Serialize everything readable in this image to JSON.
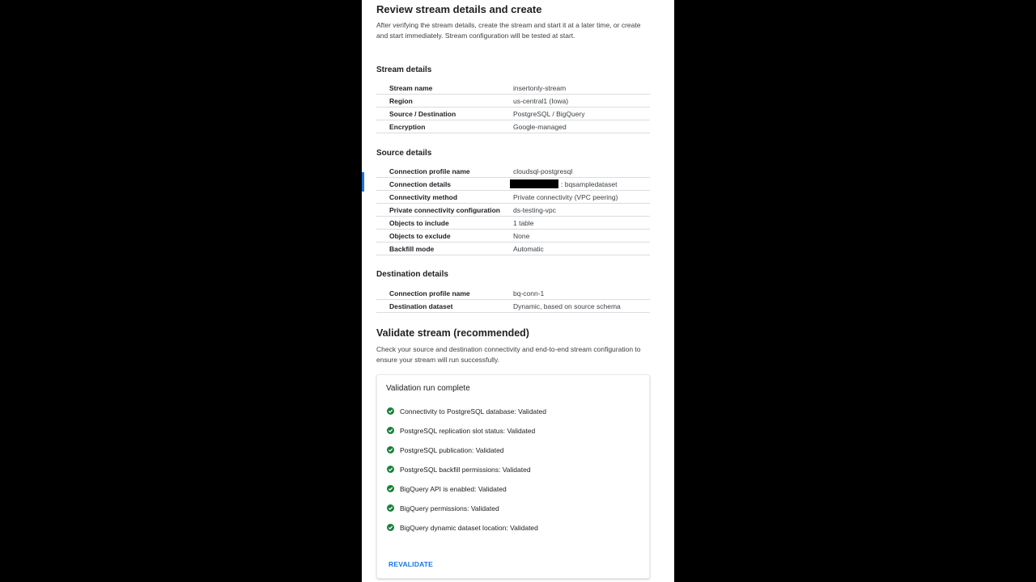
{
  "page": {
    "title": "Review stream details and create",
    "description": "After verifying the stream details, create the stream and start it at a later time, or create and start immediately. Stream configuration will be tested at start."
  },
  "stream_details": {
    "title": "Stream details",
    "rows": [
      {
        "label": "Stream name",
        "value": "insertonly-stream"
      },
      {
        "label": "Region",
        "value": "us-central1 (Iowa)"
      },
      {
        "label": "Source / Destination",
        "value": "PostgreSQL / BigQuery"
      },
      {
        "label": "Encryption",
        "value": "Google-managed"
      }
    ]
  },
  "source_details": {
    "title": "Source details",
    "rows": [
      {
        "label": "Connection profile name",
        "value": "cloudsql-postgresql"
      },
      {
        "label": "Connection details",
        "value": ": bqsampledataset"
      },
      {
        "label": "Connectivity method",
        "value": "Private connectivity (VPC peering)"
      },
      {
        "label": "Private connectivity configuration",
        "value": "ds-testing-vpc"
      },
      {
        "label": "Objects to include",
        "value": "1 table"
      },
      {
        "label": "Objects to exclude",
        "value": "None"
      },
      {
        "label": "Backfill mode",
        "value": "Automatic"
      }
    ]
  },
  "destination_details": {
    "title": "Destination details",
    "rows": [
      {
        "label": "Connection profile name",
        "value": "bq-conn-1"
      },
      {
        "label": "Destination dataset",
        "value": "Dynamic, based on source schema"
      }
    ]
  },
  "validate": {
    "title": "Validate stream (recommended)",
    "description": "Check your source and destination connectivity and end-to-end stream configuration to ensure your stream will run successfully.",
    "card_title": "Validation run complete",
    "checks": [
      "Connectivity to PostgreSQL database: Validated",
      "PostgreSQL replication slot status: Validated",
      "PostgreSQL publication: Validated",
      "PostgreSQL backfill permissions: Validated",
      "BigQuery API is enabled: Validated",
      "BigQuery permissions: Validated",
      "BigQuery dynamic dataset location: Validated"
    ],
    "revalidate_label": "REVALIDATE"
  },
  "colors": {
    "accent": "#1a73e8",
    "success": "#188038",
    "background": "#000000",
    "panel": "#ffffff"
  },
  "icons": {
    "check": "check-circle-icon"
  }
}
